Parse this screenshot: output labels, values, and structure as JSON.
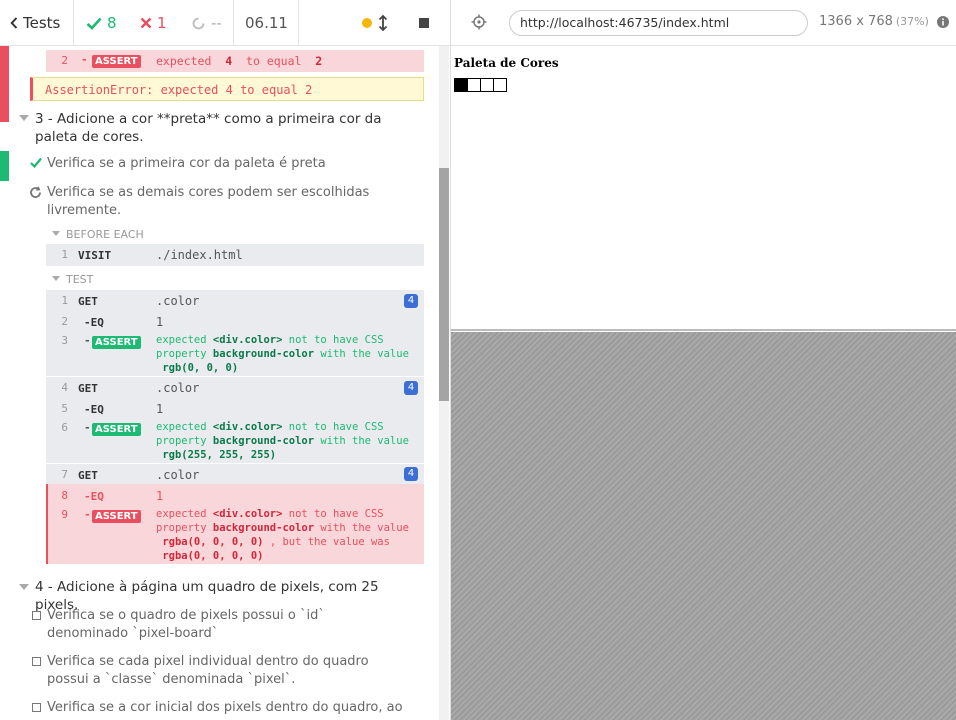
{
  "topbar": {
    "back_label": "Tests",
    "passed": "8",
    "failed": "1",
    "pending": "--",
    "duration": "06.11"
  },
  "suite2": {
    "last_cmd": {
      "num": "2",
      "name": "ASSERT",
      "msg_pre": "expected",
      "val1": "4",
      "msg_mid": "to equal",
      "val2": "2"
    },
    "error": "AssertionError: expected 4 to equal 2"
  },
  "suite3": {
    "title": "3 - Adicione a cor **preta** como a primeira cor da paleta de cores.",
    "test1": "Verifica se a primeira cor da paleta é preta",
    "test2": "Verifica se as demais cores podem ser escolhidas livremente.",
    "before_each_label": "BEFORE EACH",
    "before_each": {
      "num": "1",
      "name": "VISIT",
      "msg": "./index.html"
    },
    "test_label": "TEST",
    "commands": [
      {
        "num": "1",
        "name": "GET",
        "msg": ".color",
        "count": "4"
      },
      {
        "num": "2",
        "name": "-EQ",
        "msg": "1"
      },
      {
        "num": "3",
        "name": "ASSERT",
        "expected": "expected",
        "el": "<div.color>",
        "not_have": "not to have CSS",
        "property": "property",
        "prop": "background-color",
        "with": "with the value",
        "value": "rgb(0, 0, 0)"
      },
      {
        "num": "4",
        "name": "GET",
        "msg": ".color",
        "count": "4"
      },
      {
        "num": "5",
        "name": "-EQ",
        "msg": "1"
      },
      {
        "num": "6",
        "name": "ASSERT",
        "expected": "expected",
        "el": "<div.color>",
        "not_have": "not to have CSS",
        "property": "property",
        "prop": "background-color",
        "with": "with the value",
        "value": "rgb(255, 255, 255)"
      },
      {
        "num": "7",
        "name": "GET",
        "msg": ".color",
        "count": "4"
      },
      {
        "num": "8",
        "name": "-EQ",
        "msg": "1"
      },
      {
        "num": "9",
        "name": "ASSERT",
        "expected": "expected",
        "el": "<div.color>",
        "not_have": "not to have CSS",
        "property": "property",
        "prop": "background-color",
        "with": "with the value",
        "value": "rgba(0, 0, 0, 0)",
        "but": ", but the value was",
        "actual": "rgba(0, 0, 0, 0)"
      }
    ]
  },
  "suite4": {
    "title": "4 - Adicione à página um quadro de pixels, com 25 pixels.",
    "tests": [
      "Verifica se o quadro de pixels possui o `id` denominado `pixel-board`",
      "Verifica se cada pixel individual dentro do quadro possui a `classe` denominada `pixel`.",
      "Verifica se a cor inicial dos pixels dentro do quadro, ao"
    ]
  },
  "aut": {
    "url": "http://localhost:46735/index.html",
    "viewport": "1366 x 768",
    "scale": "(37%)",
    "app_title": "Paleta de Cores",
    "palette": [
      "#000000",
      "#ffffff",
      "#ffffff",
      "#ffffff"
    ]
  },
  "colors": {
    "pass": "#1cba72",
    "fail": "#e94f5f",
    "accent": "#3b6fd6"
  }
}
